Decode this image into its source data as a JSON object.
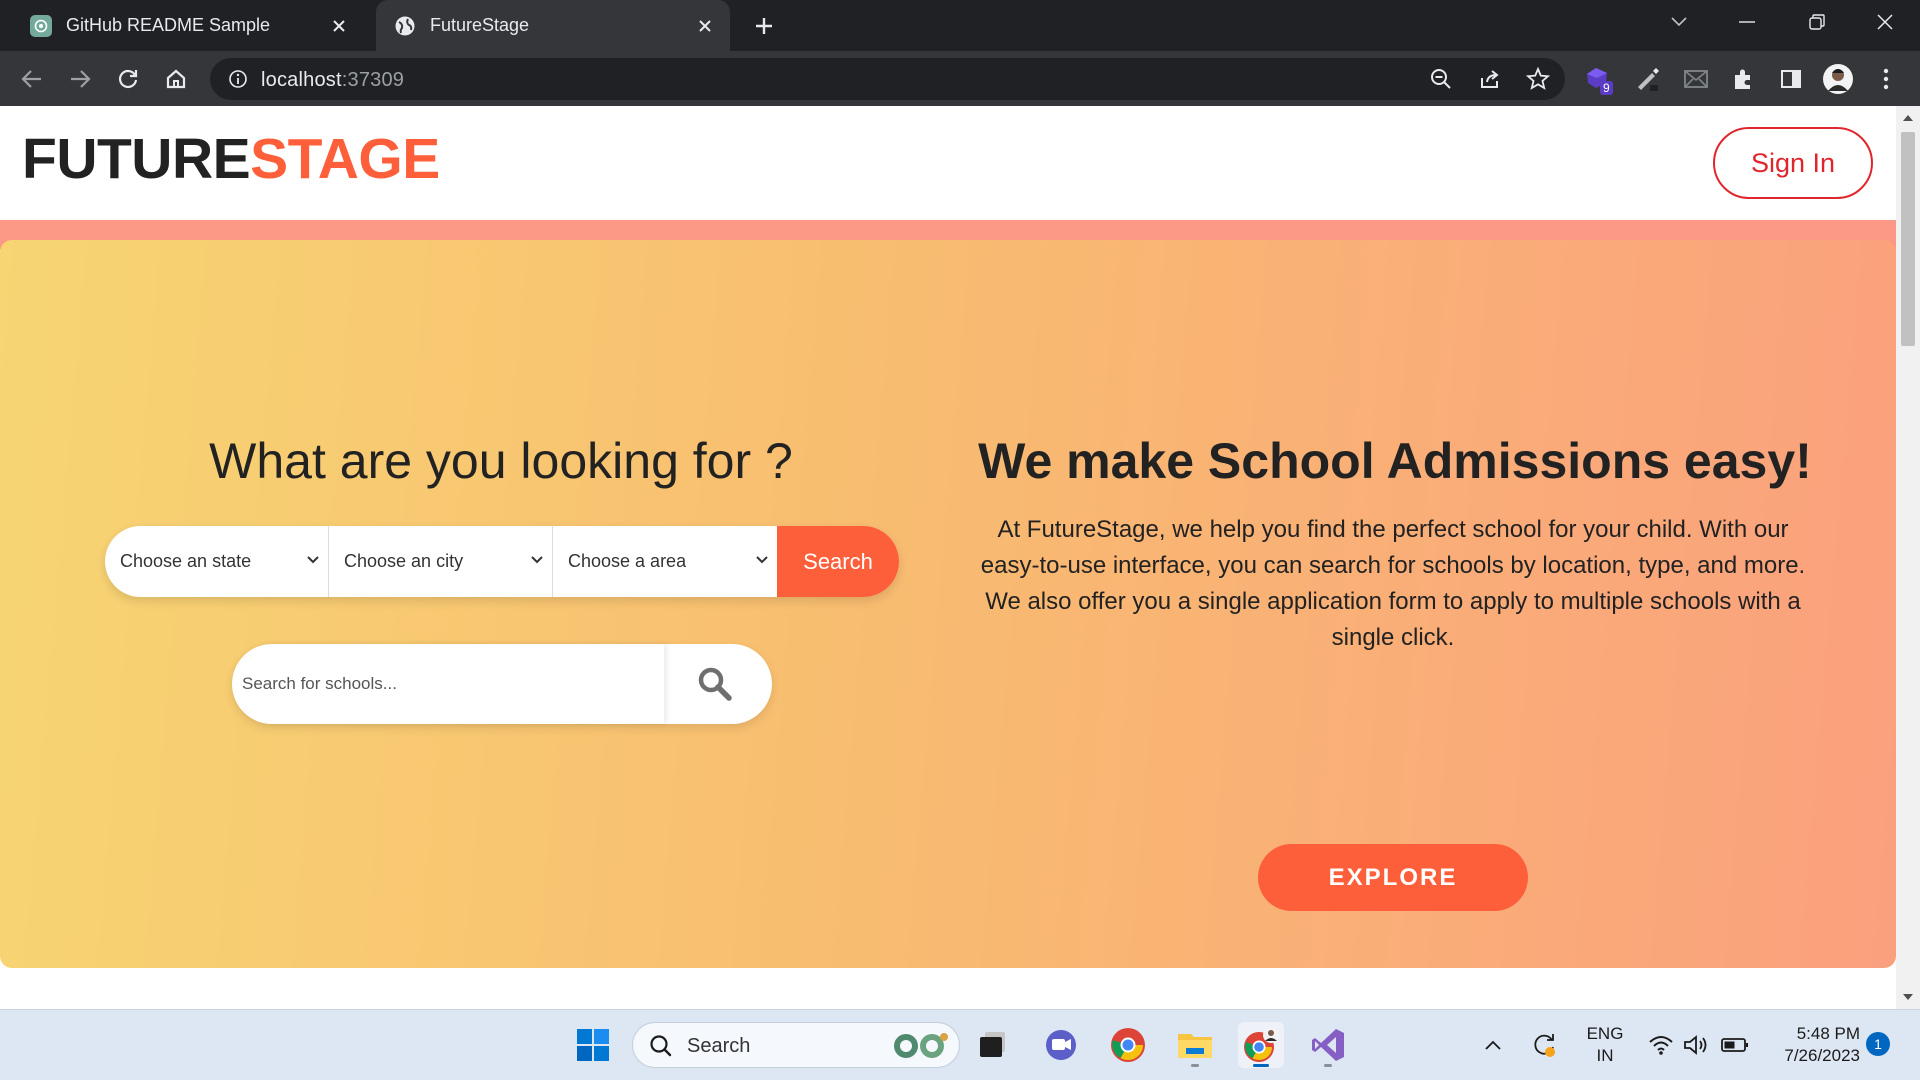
{
  "browser": {
    "tabs": [
      {
        "title": "GitHub README Sample",
        "icon": "chatgpt-icon",
        "active": false
      },
      {
        "title": "FutureStage",
        "icon": "globe-icon",
        "active": true
      }
    ],
    "url_host": "localhost",
    "url_port": ":37309",
    "extension_badge": "9"
  },
  "site": {
    "logo_part1": "FUTURE",
    "logo_part2": "STAGE",
    "signin_label": "Sign In",
    "colors": {
      "accent": "#fd5f3a",
      "signin": "#e0262d",
      "dark": "#222222"
    }
  },
  "hero": {
    "left_title": "What are you looking for ?",
    "filters": {
      "state_placeholder": "Choose an state",
      "city_placeholder": "Choose an city",
      "area_placeholder": "Choose a area",
      "search_label": "Search"
    },
    "school_search_placeholder": "Search for schools...",
    "right_title": "We make School Admissions easy!",
    "description": "At FutureStage, we help you find the perfect school for your child. With our easy-to-use interface, you can search for schools by location, type, and more. We also offer you a single application form to apply to multiple schools with a single click.",
    "explore_label": "EXPLORE"
  },
  "taskbar": {
    "search_label": "Search",
    "lang_line1": "ENG",
    "lang_line2": "IN",
    "time": "5:48 PM",
    "date": "7/26/2023",
    "notification_count": "1"
  }
}
